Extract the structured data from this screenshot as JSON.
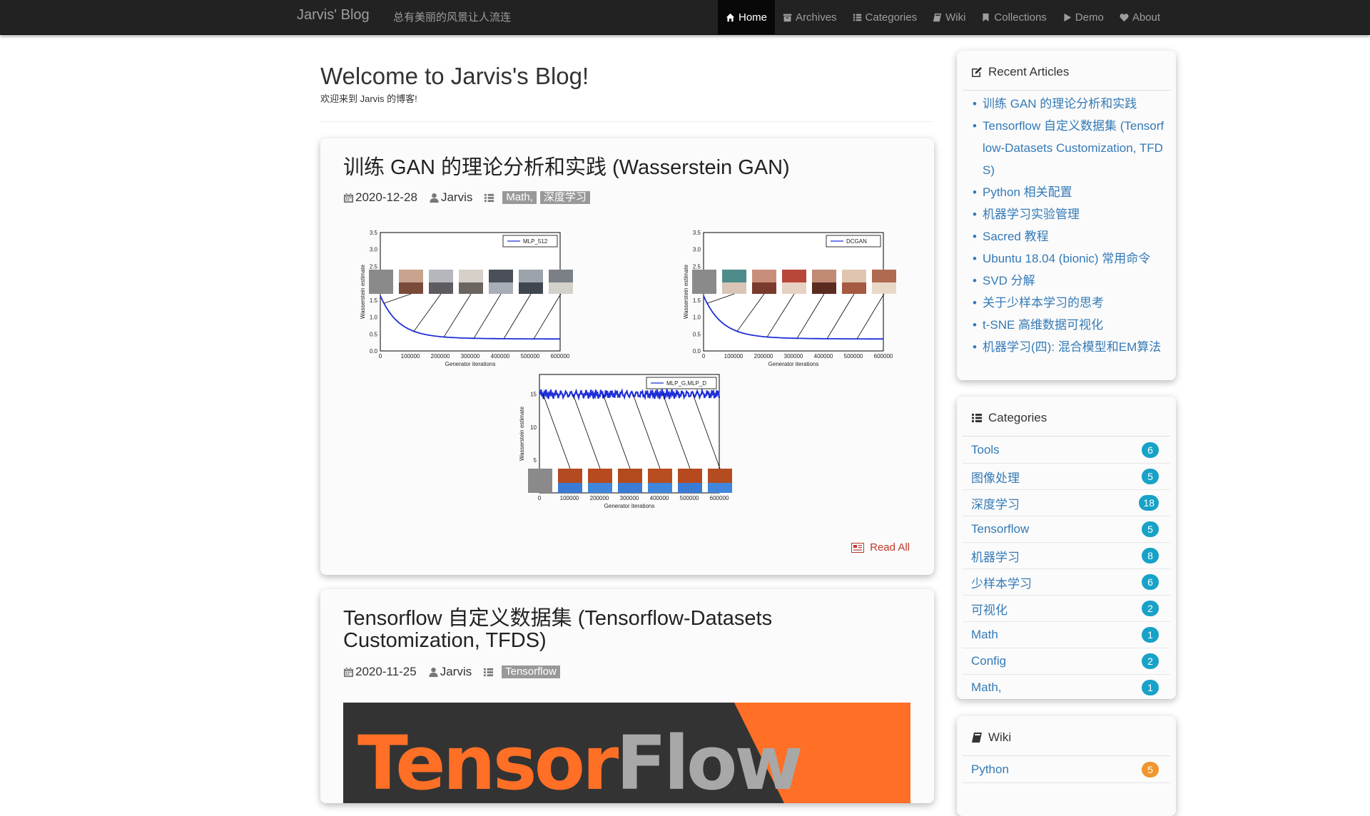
{
  "navbar": {
    "brand": "Jarvis' Blog",
    "tagline": "总有美丽的风景让人流连",
    "items": [
      {
        "label": "Home",
        "icon": "home-icon",
        "active": true
      },
      {
        "label": "Archives",
        "icon": "archive-icon"
      },
      {
        "label": "Categories",
        "icon": "list-icon"
      },
      {
        "label": "Wiki",
        "icon": "book-icon"
      },
      {
        "label": "Collections",
        "icon": "bookmark-icon"
      },
      {
        "label": "Demo",
        "icon": "play-icon"
      },
      {
        "label": "About",
        "icon": "heart-icon"
      }
    ]
  },
  "header": {
    "title": "Welcome to Jarvis's Blog!",
    "subtitle": "欢迎来到 Jarvis 的博客!"
  },
  "posts": [
    {
      "title": "训练 GAN 的理论分析和实践 (Wasserstein GAN)",
      "date": "2020-12-28",
      "author": "Jarvis",
      "tags": [
        "Math,",
        "深度学习"
      ],
      "read_all": "Read All",
      "figure": {
        "panels": [
          {
            "legend": "MLP_512",
            "ylabel": "Wasserstein estimate",
            "xlabel": "Generator iterations",
            "xticks": [
              "0",
              "100000",
              "200000",
              "300000",
              "400000",
              "500000",
              "600000"
            ],
            "yticks": [
              "0.0",
              "0.5",
              "1.0",
              "1.5",
              "2.0",
              "2.5",
              "3.0",
              "3.5"
            ]
          },
          {
            "legend": "DCGAN",
            "ylabel": "Wasserstein estimate",
            "xlabel": "Generator iterations",
            "xticks": [
              "0",
              "100000",
              "200000",
              "300000",
              "400000",
              "500000",
              "600000"
            ],
            "yticks": [
              "0.0",
              "0.5",
              "1.0",
              "1.5",
              "2.0",
              "2.5",
              "3.0",
              "3.5"
            ]
          },
          {
            "legend": "MLP_G,MLP_D",
            "ylabel": "Wasserstein estimate",
            "xlabel": "Generator iterations",
            "xticks": [
              "0",
              "100000",
              "200000",
              "300000",
              "400000",
              "500000",
              "600000"
            ],
            "yticks": [
              "5",
              "10",
              "15"
            ]
          }
        ]
      }
    },
    {
      "title": "Tensorflow 自定义数据集 (Tensorflow-Datasets Customization, TFDS)",
      "date": "2020-11-25",
      "author": "Jarvis",
      "tags": [
        "Tensorflow"
      ],
      "banner": {
        "word1": "Tensor",
        "word2": "Flow"
      }
    }
  ],
  "sidebar": {
    "recent": {
      "title": "Recent Articles",
      "items": [
        "训练 GAN 的理论分析和实践",
        "Tensorflow 自定义数据集 (Tensorflow-Datasets Customization, TFDS)",
        "Python 相关配置",
        "机器学习实验管理",
        "Sacred 教程",
        "Ubuntu 18.04 (bionic) 常用命令",
        "SVD 分解",
        "关于少样本学习的思考",
        "t-SNE 高维数据可视化",
        "机器学习(四): 混合模型和EM算法"
      ]
    },
    "categories": {
      "title": "Categories",
      "items": [
        {
          "name": "Tools",
          "count": "6"
        },
        {
          "name": "图像处理",
          "count": "5"
        },
        {
          "name": "深度学习",
          "count": "18"
        },
        {
          "name": "Tensorflow",
          "count": "5"
        },
        {
          "name": "机器学习",
          "count": "8"
        },
        {
          "name": "少样本学习",
          "count": "6"
        },
        {
          "name": "可视化",
          "count": "2"
        },
        {
          "name": "Math",
          "count": "1"
        },
        {
          "name": "Config",
          "count": "2"
        },
        {
          "name": "Math,",
          "count": "1"
        }
      ]
    },
    "wiki": {
      "title": "Wiki",
      "items": [
        {
          "name": "Python",
          "count": "5"
        }
      ]
    }
  },
  "colors": {
    "navbar_bg": "#222222",
    "link": "#337ab7",
    "badge": "#17a2c8",
    "badge_wiki": "#f0962d",
    "read_all": "#c0392b",
    "tf_orange": "#ff6f25"
  }
}
